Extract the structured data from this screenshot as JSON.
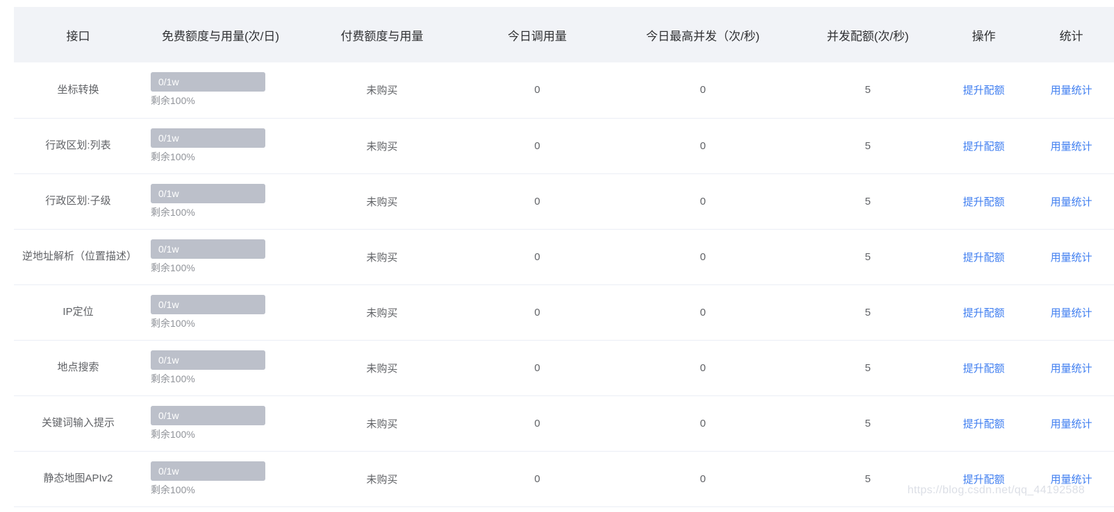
{
  "columns": [
    "接口",
    "免费额度与用量(次/日)",
    "付费额度与用量",
    "今日调用量",
    "今日最高并发（次/秒)",
    "并发配额(次/秒)",
    "操作",
    "统计"
  ],
  "rows": [
    {
      "name": "坐标转换",
      "free_usage": "0/1w",
      "used_fraction": 1.0,
      "remaining": "剩余100%",
      "paid": "未购买",
      "today_calls": "0",
      "peak_concurrency": "0",
      "concurrency_quota": "5",
      "action": "提升配额",
      "stats": "用量统计"
    },
    {
      "name": "行政区划:列表",
      "free_usage": "0/1w",
      "used_fraction": 1.0,
      "remaining": "剩余100%",
      "paid": "未购买",
      "today_calls": "0",
      "peak_concurrency": "0",
      "concurrency_quota": "5",
      "action": "提升配额",
      "stats": "用量统计"
    },
    {
      "name": "行政区划:子级",
      "free_usage": "0/1w",
      "used_fraction": 1.0,
      "remaining": "剩余100%",
      "paid": "未购买",
      "today_calls": "0",
      "peak_concurrency": "0",
      "concurrency_quota": "5",
      "action": "提升配额",
      "stats": "用量统计"
    },
    {
      "name": "逆地址解析（位置描述）",
      "free_usage": "0/1w",
      "used_fraction": 1.0,
      "remaining": "剩余100%",
      "paid": "未购买",
      "today_calls": "0",
      "peak_concurrency": "0",
      "concurrency_quota": "5",
      "action": "提升配额",
      "stats": "用量统计"
    },
    {
      "name": "IP定位",
      "free_usage": "0/1w",
      "used_fraction": 1.0,
      "remaining": "剩余100%",
      "paid": "未购买",
      "today_calls": "0",
      "peak_concurrency": "0",
      "concurrency_quota": "5",
      "action": "提升配额",
      "stats": "用量统计"
    },
    {
      "name": "地点搜索",
      "free_usage": "0/1w",
      "used_fraction": 1.0,
      "remaining": "剩余100%",
      "paid": "未购买",
      "today_calls": "0",
      "peak_concurrency": "0",
      "concurrency_quota": "5",
      "action": "提升配额",
      "stats": "用量统计"
    },
    {
      "name": "关键词输入提示",
      "free_usage": "0/1w",
      "used_fraction": 1.0,
      "remaining": "剩余100%",
      "paid": "未购买",
      "today_calls": "0",
      "peak_concurrency": "0",
      "concurrency_quota": "5",
      "action": "提升配额",
      "stats": "用量统计"
    },
    {
      "name": "静态地图APIv2",
      "free_usage": "0/1w",
      "used_fraction": 1.0,
      "remaining": "剩余100%",
      "paid": "未购买",
      "today_calls": "0",
      "peak_concurrency": "0",
      "concurrency_quota": "5",
      "action": "提升配额",
      "stats": "用量统计"
    }
  ],
  "watermark": "https://blog.csdn.net/qq_44192588",
  "colors": {
    "header_bg": "#f1f3f7",
    "bar_fill": "#bcc0ca",
    "link": "#3f7ef0"
  }
}
